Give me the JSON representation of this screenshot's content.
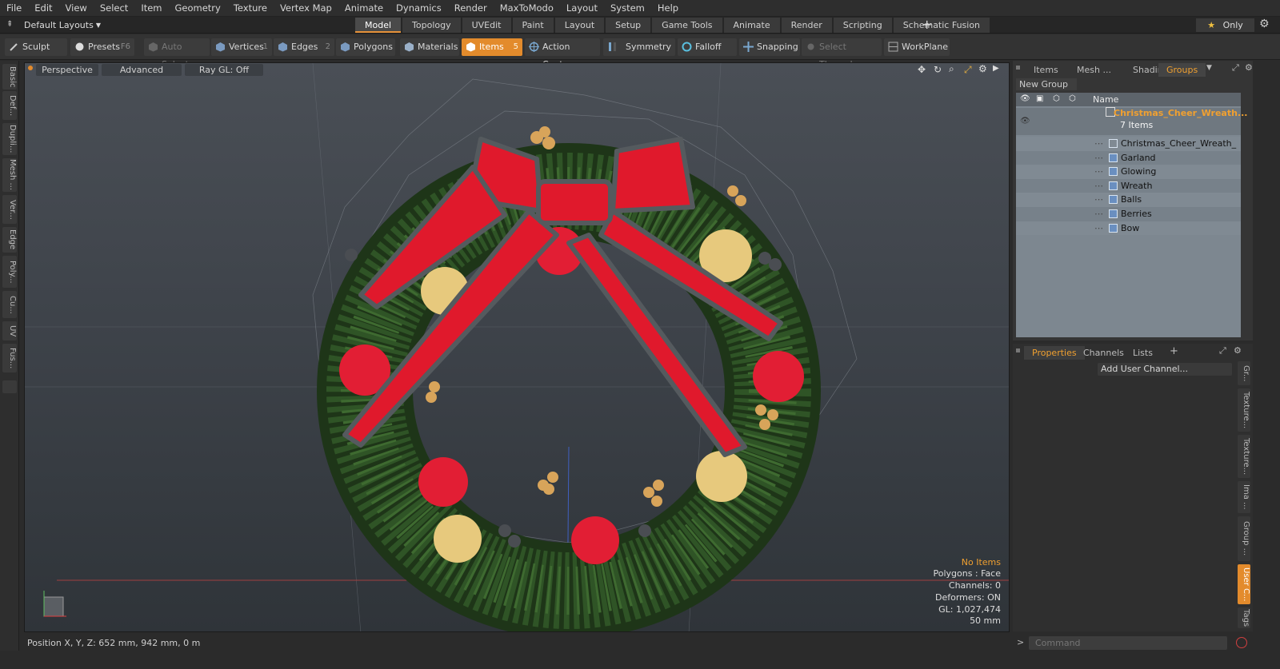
{
  "menu": [
    "File",
    "Edit",
    "View",
    "Select",
    "Item",
    "Geometry",
    "Texture",
    "Vertex Map",
    "Animate",
    "Dynamics",
    "Render",
    "MaxToModo",
    "Layout",
    "System",
    "Help"
  ],
  "layout": {
    "selector": "Default Layouts",
    "tabs": [
      "Model",
      "Topology",
      "UVEdit",
      "Paint",
      "Layout",
      "Setup",
      "Game Tools",
      "Animate",
      "Render",
      "Scripting",
      "Schematic Fusion"
    ],
    "only": "Only"
  },
  "toolbar": {
    "sculpt": "Sculpt",
    "presets": "Presets",
    "presets_key": "F6",
    "auto_select": "Auto Select",
    "vertices": "Vertices",
    "vertices_key": "1",
    "edges": "Edges",
    "edges_key": "2",
    "polygons": "Polygons",
    "materials": "Materials",
    "items": "Items",
    "items_key": "5",
    "action_center": "Action Center",
    "symmetry": "Symmetry",
    "falloff": "Falloff",
    "snapping": "Snapping",
    "select_through": "Select Through",
    "workplane": "WorkPlane"
  },
  "left_tabs": [
    "Basic",
    "Def...",
    "Dupli...",
    "Mesh ...",
    "Ver...",
    "Edge",
    "Poly...",
    "Cu...",
    "UV",
    "Fus..."
  ],
  "viewport": {
    "view": "Perspective",
    "shading": "Advanced",
    "raygl": "Ray GL: Off",
    "hud": {
      "selection": "No Items",
      "polygons": "Polygons : Face",
      "channels": "Channels: 0",
      "deformers": "Deformers: ON",
      "gl": "GL: 1,027,474",
      "scale": "50 mm"
    }
  },
  "status": "Position X, Y, Z:   652 mm, 942 mm, 0 m",
  "items_panel": {
    "tabs": [
      "Items",
      "Mesh ...",
      "Shading",
      "Groups"
    ],
    "new_group": "New Group",
    "column_name": "Name",
    "group_name": "Christmas_Cheer_Wreath...",
    "group_count": "7 Items",
    "children": [
      "Christmas_Cheer_Wreath_ ...",
      "Garland",
      "Glowing",
      "Wreath",
      "Balls",
      "Berries",
      "Bow"
    ]
  },
  "properties_panel": {
    "tabs": [
      "Properties",
      "Channels",
      "Lists"
    ],
    "add_user_channel": "Add User Channel...",
    "side_tabs": [
      "Gr...",
      "Texture...",
      "Texture...",
      "Ima ...",
      "Group ...",
      "User C...",
      "Tags"
    ]
  },
  "command": {
    "placeholder": "Command"
  },
  "colors": {
    "accent": "#e38b2c",
    "bow_red": "#e0192c",
    "pine": "#2c4a22",
    "gold": "#e6c77a"
  }
}
